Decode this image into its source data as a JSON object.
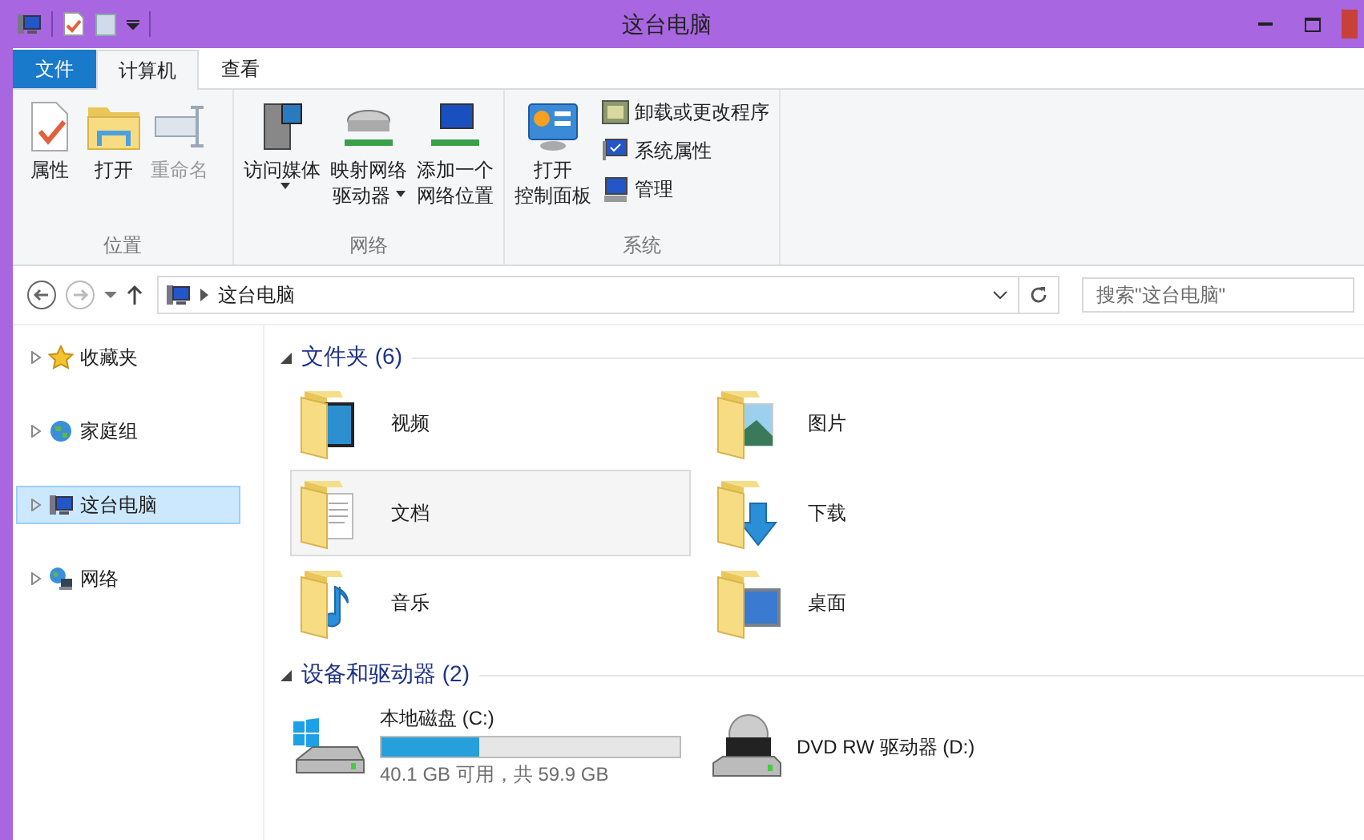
{
  "window": {
    "title": "这台电脑"
  },
  "tabs": [
    {
      "label": "文件",
      "kind": "file",
      "selected": false
    },
    {
      "label": "计算机",
      "kind": "tab",
      "selected": true
    },
    {
      "label": "查看",
      "kind": "tab",
      "selected": false
    }
  ],
  "ribbon": {
    "groups": [
      {
        "label": "位置",
        "items": [
          {
            "kind": "large",
            "lines": [
              "属性"
            ],
            "disabled": false,
            "dropdown": false
          },
          {
            "kind": "large",
            "lines": [
              "打开"
            ],
            "disabled": false,
            "dropdown": false
          },
          {
            "kind": "large",
            "lines": [
              "重命名"
            ],
            "disabled": true,
            "dropdown": false
          }
        ]
      },
      {
        "label": "网络",
        "items": [
          {
            "kind": "large",
            "lines": [
              "访问媒体"
            ],
            "disabled": false,
            "dropdown": true
          },
          {
            "kind": "large",
            "lines": [
              "映射网络",
              "驱动器"
            ],
            "disabled": false,
            "dropdown": true
          },
          {
            "kind": "large",
            "lines": [
              "添加一个",
              "网络位置"
            ],
            "disabled": false,
            "dropdown": false
          }
        ]
      },
      {
        "label": "系统",
        "items": [
          {
            "kind": "large",
            "lines": [
              "打开",
              "控制面板"
            ],
            "disabled": false,
            "dropdown": false
          },
          {
            "kind": "small",
            "lines": [
              "卸载或更改程序"
            ],
            "disabled": false
          },
          {
            "kind": "small",
            "lines": [
              "系统属性"
            ],
            "disabled": false
          },
          {
            "kind": "small",
            "lines": [
              "管理"
            ],
            "disabled": false
          }
        ]
      }
    ]
  },
  "address": {
    "path": "这台电脑",
    "search_placeholder": "搜索\"这台电脑\""
  },
  "navigation": [
    {
      "label": "收藏夹",
      "selected": false
    },
    {
      "label": "家庭组",
      "selected": false
    },
    {
      "label": "这台电脑",
      "selected": true
    },
    {
      "label": "网络",
      "selected": false
    }
  ],
  "folders": {
    "heading": "文件夹 (6)",
    "items": [
      {
        "label": "视频",
        "selected": false
      },
      {
        "label": "图片",
        "selected": false
      },
      {
        "label": "文档",
        "selected": true
      },
      {
        "label": "下载",
        "selected": false
      },
      {
        "label": "音乐",
        "selected": false
      },
      {
        "label": "桌面",
        "selected": false
      }
    ]
  },
  "drives": {
    "heading": "设备和驱动器 (2)",
    "items": [
      {
        "kind": "disk",
        "label": "本地磁盘 (C:)",
        "level": 0.33,
        "detail": "40.1 GB 可用，共 59.9 GB"
      },
      {
        "kind": "optical",
        "label": "DVD RW 驱动器 (D:)"
      }
    ]
  }
}
